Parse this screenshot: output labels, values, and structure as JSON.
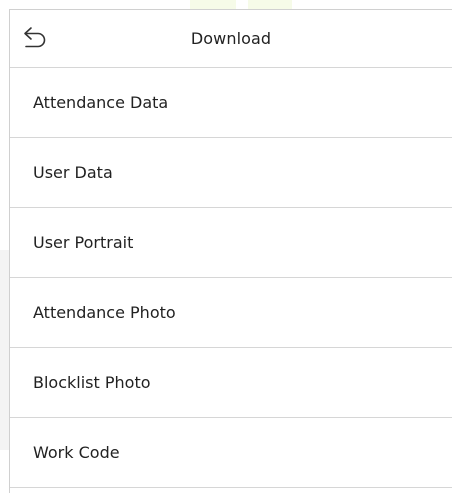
{
  "header": {
    "title": "Download",
    "back_icon": "back-arrow-icon"
  },
  "menu": {
    "items": [
      {
        "label": "Attendance Data"
      },
      {
        "label": "User Data"
      },
      {
        "label": "User Portrait"
      },
      {
        "label": "Attendance Photo"
      },
      {
        "label": "Blocklist Photo"
      },
      {
        "label": "Work Code"
      }
    ]
  }
}
